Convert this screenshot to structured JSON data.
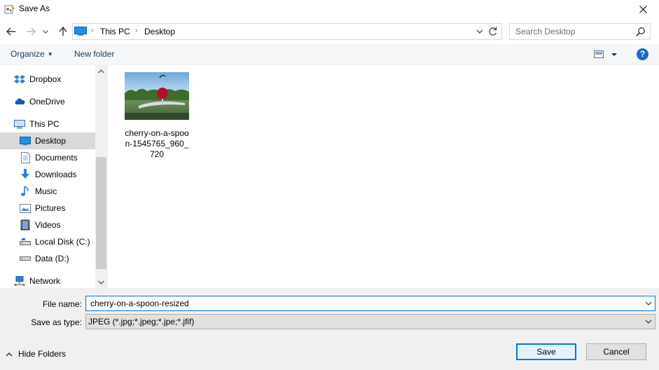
{
  "window": {
    "title": "Save As"
  },
  "address": {
    "crumbs": [
      "This PC",
      "Desktop"
    ]
  },
  "search": {
    "placeholder": "Search Desktop"
  },
  "toolbar": {
    "organize": "Organize",
    "new_folder": "New folder",
    "help": "?"
  },
  "nav": {
    "items": [
      {
        "label": "Dropbox",
        "icon": "dropbox-icon"
      },
      {
        "label": "OneDrive",
        "icon": "onedrive-icon"
      },
      {
        "label": "This PC",
        "icon": "computer-icon"
      },
      {
        "label": "Desktop",
        "icon": "desktop-icon",
        "selected": true
      },
      {
        "label": "Documents",
        "icon": "documents-icon"
      },
      {
        "label": "Downloads",
        "icon": "downloads-icon"
      },
      {
        "label": "Music",
        "icon": "music-icon"
      },
      {
        "label": "Pictures",
        "icon": "pictures-icon"
      },
      {
        "label": "Videos",
        "icon": "videos-icon"
      },
      {
        "label": "Local Disk (C:)",
        "icon": "local-disk-icon"
      },
      {
        "label": "Data (D:)",
        "icon": "drive-icon"
      },
      {
        "label": "Network",
        "icon": "network-icon"
      }
    ]
  },
  "files": [
    {
      "name": "cherry-on-a-spoon-1545765_960_720"
    }
  ],
  "form": {
    "file_name_label": "File name:",
    "file_name_value": "cherry-on-a-spoon-resized",
    "type_label": "Save as type:",
    "type_value": "JPEG (*.jpg;*.jpeg;*.jpe;*.jfif)"
  },
  "footer": {
    "hide_folders": "Hide Folders",
    "save": "Save",
    "cancel": "Cancel"
  },
  "colors": {
    "accent": "#0078d7",
    "selection": "#d9d9d9",
    "bottom_panel": "#f0f0f0"
  }
}
